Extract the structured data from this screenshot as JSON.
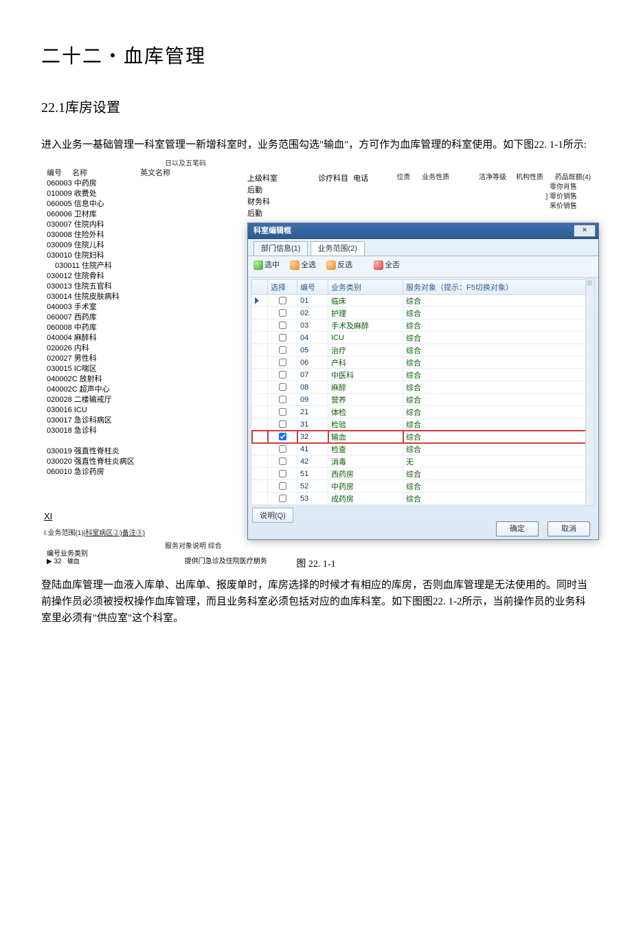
{
  "doc": {
    "title": "二十二・血库管理",
    "section": "22.1库房设置",
    "para1": "进入业务一基础管理一科室管理一新增科室时，业务范围勾选\"输血\"，方可作为血库管理的科室使用。如下图22. 1-1所示:",
    "caption": "图  22. 1-1",
    "para2": "登陆血库管理一血液入库单、出库单、报废单时，库房选择的时候才有相应的库房，否则血库管理是无法使用的。同时当前操作员必须被授权操作血库管理，而且业务科室必须包括对应的血库科室。如下图图22. 1-2所示，当前操作员的业务科室里必须有\"供应室\"这个科室。"
  },
  "topnote": "日以及五笔码",
  "header_cols": {
    "code": "编号",
    "name": "名称",
    "eng": "英文名称",
    "parent": "上级科室",
    "clinic": "诊疗科目",
    "phone": "电话",
    "pos": "位责",
    "biz": "业务性质",
    "clean": "洁净等级",
    "org": "机构性质",
    "quota": "药品既额(4)"
  },
  "mid_rows": [
    "后勤",
    "财务科",
    "后勤"
  ],
  "right_rows": [
    "零你肖售",
    "] 零价销售",
    "釆价销售"
  ],
  "departments": [
    {
      "code": "060003",
      "name": "中药房",
      "indent": 0
    },
    {
      "code": "010009",
      "name": "收费处",
      "indent": 0
    },
    {
      "code": "060005",
      "name": "信息中心",
      "indent": 0
    },
    {
      "code": "060006",
      "name": "卫材库",
      "indent": 0
    },
    {
      "code": "030007",
      "name": "住院内科",
      "indent": 0
    },
    {
      "code": "030008",
      "name": "住险外科",
      "indent": 0
    },
    {
      "code": "030009",
      "name": "住院儿科",
      "indent": 0
    },
    {
      "code": "030010",
      "name": "住院妇科",
      "indent": 0
    },
    {
      "code": "030011",
      "name": "住院产科",
      "indent": 1
    },
    {
      "code": "030012",
      "name": "住院骨科",
      "indent": 0
    },
    {
      "code": "030013",
      "name": "住院五官科",
      "indent": 0
    },
    {
      "code": "030014",
      "name": "住院皮肤病科",
      "indent": 0
    },
    {
      "code": "040003",
      "name": "手术室",
      "indent": 0
    },
    {
      "code": "060007",
      "name": "西药库",
      "indent": 0
    },
    {
      "code": "060008",
      "name": "中药库",
      "indent": 0
    },
    {
      "code": "040004",
      "name": "麻醉科",
      "indent": 0
    },
    {
      "code": "020026",
      "name": "内科",
      "indent": 0
    },
    {
      "code": "020027",
      "name": "男性科",
      "indent": 0
    },
    {
      "code": "030015",
      "name": "IC喘区",
      "indent": 0
    },
    {
      "code": "040002C",
      "name": "放射科",
      "indent": 0
    },
    {
      "code": "040002C",
      "name": "超声中心",
      "indent": 0
    },
    {
      "code": "020028",
      "name": "二楼输戒厅",
      "indent": 0
    },
    {
      "code": "030016",
      "name": "ICU",
      "indent": 0
    },
    {
      "code": "030017",
      "name": "急诊科病区",
      "indent": 0
    },
    {
      "code": "030018",
      "name": "急诊科",
      "indent": 0
    },
    {
      "code": "",
      "name": "",
      "indent": 0
    },
    {
      "code": "030019",
      "name": "强直性脊柱炎",
      "indent": 0
    },
    {
      "code": "030020",
      "name": "强直性脊柱炎病区",
      "indent": 0
    },
    {
      "code": "060010",
      "name": "急诊药房",
      "indent": 0
    }
  ],
  "dialog": {
    "title": "科室编辑框",
    "close": "×",
    "tabs": [
      "部门信息(1)",
      "业务范围(2)"
    ],
    "active_tab": 1,
    "toolbar": {
      "select": "选中",
      "all": "全选",
      "invert": "反选",
      "none": "全否"
    },
    "grid": {
      "columns": [
        "选择",
        "编号",
        "业务类别",
        "服务对象（提示：F5切换对象）"
      ],
      "rows": [
        {
          "chk": false,
          "num": "01",
          "cat": "临床",
          "tgt": "综合",
          "mark": true
        },
        {
          "chk": false,
          "num": "02",
          "cat": "护理",
          "tgt": "综合"
        },
        {
          "chk": false,
          "num": "03",
          "cat": "手术及麻醉",
          "tgt": "综合"
        },
        {
          "chk": false,
          "num": "04",
          "cat": "ICU",
          "tgt": "综合"
        },
        {
          "chk": false,
          "num": "05",
          "cat": "治疗",
          "tgt": "综合"
        },
        {
          "chk": false,
          "num": "06",
          "cat": "产科",
          "tgt": "综合"
        },
        {
          "chk": false,
          "num": "07",
          "cat": "中医科",
          "tgt": "综合"
        },
        {
          "chk": false,
          "num": "08",
          "cat": "麻醉",
          "tgt": "综合"
        },
        {
          "chk": false,
          "num": "09",
          "cat": "营养",
          "tgt": "综合"
        },
        {
          "chk": false,
          "num": "21",
          "cat": "体检",
          "tgt": "综合"
        },
        {
          "chk": false,
          "num": "31",
          "cat": "检验",
          "tgt": "综合"
        },
        {
          "chk": true,
          "num": "32",
          "cat": "输血",
          "tgt": "综合",
          "hl": true
        },
        {
          "chk": false,
          "num": "41",
          "cat": "检查",
          "tgt": "综合"
        },
        {
          "chk": false,
          "num": "42",
          "cat": "消毒",
          "tgt": "无"
        },
        {
          "chk": false,
          "num": "51",
          "cat": "西药房",
          "tgt": "综合"
        },
        {
          "chk": false,
          "num": "52",
          "cat": "中药房",
          "tgt": "综合"
        },
        {
          "chk": false,
          "num": "53",
          "cat": "成药房",
          "tgt": "综合"
        }
      ]
    },
    "explain": "说明(Q)",
    "ok": "确定",
    "cancel": "取消"
  },
  "bottom": {
    "xi": "XI",
    "tabs_prefix": "I.业务范围(1)|",
    "tabs_u1": "科室病区②)",
    "tabs_u2": "备注③)",
    "svc_label": "服务对象说明",
    "svc_val": "综合",
    "small_label": "编号业务类别",
    "small_val1": "▶ 32",
    "small_val2": "输血",
    "svc_note": "提供门急诊及住院医疗朋务"
  }
}
